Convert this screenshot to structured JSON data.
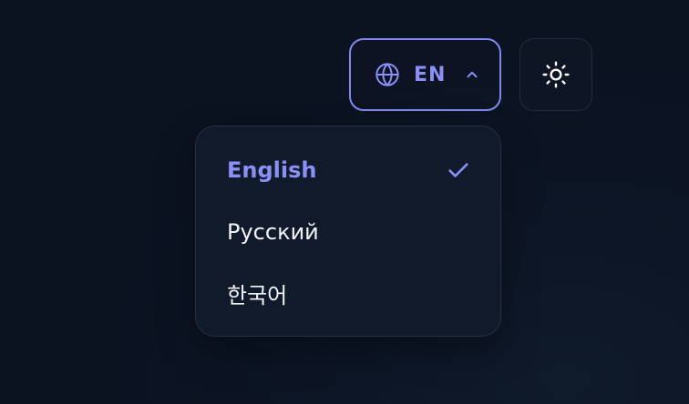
{
  "language_switcher": {
    "current_code": "EN",
    "accent_color": "#8a90f5",
    "icon": "globe-icon",
    "chevron_icon": "chevron-up-icon",
    "expanded": true
  },
  "theme_toggle": {
    "icon": "sun-icon"
  },
  "dropdown": {
    "options": [
      {
        "label": "English",
        "selected": true,
        "icon": "check-icon"
      },
      {
        "label": "Русский",
        "selected": false
      },
      {
        "label": "한국어",
        "selected": false
      }
    ]
  }
}
